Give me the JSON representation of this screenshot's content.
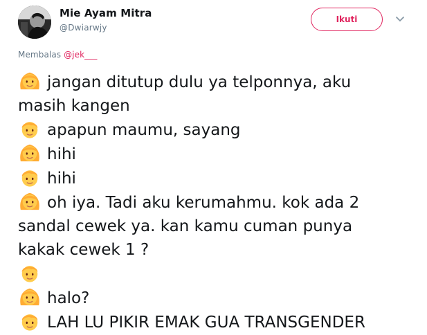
{
  "tweet": {
    "author": {
      "display_name": "Mie Ayam Mitra",
      "handle": "@Dwiarwjy",
      "avatar_icon": "profile-photo-avatar"
    },
    "follow_button": {
      "label": "Ikuti"
    },
    "menu_icon": "chevron-down-icon",
    "reply": {
      "prefix": "Membalas",
      "mention": "@jek___"
    },
    "lines": [
      {
        "emoji": "girl-emoji",
        "text": "jangan ditutup dulu ya telponnya, aku"
      },
      {
        "emoji": "",
        "text": "masih kangen"
      },
      {
        "emoji": "boy-emoji",
        "text": "apapun maumu, sayang"
      },
      {
        "emoji": "girl-emoji",
        "text": "hihi"
      },
      {
        "emoji": "boy-emoji",
        "text": "hihi"
      },
      {
        "emoji": "girl-emoji",
        "text": "oh iya. Tadi aku kerumahmu. kok ada 2"
      },
      {
        "emoji": "",
        "text": "sandal cewek ya. kan kamu cuman punya"
      },
      {
        "emoji": "",
        "text": "kakak cewek 1 ?"
      },
      {
        "emoji": "boy-emoji",
        "text": ""
      },
      {
        "emoji": "girl-emoji",
        "text": "halo?"
      },
      {
        "emoji": "boy-emoji",
        "text": "LAH LU PIKIR EMAK GUA TRANSGENDER"
      }
    ],
    "colors": {
      "accent": "#e0245e",
      "secondary_text": "#657786",
      "primary_text": "#14171a",
      "emoji_skin": "#ffcc4d",
      "emoji_hair": "#ffac33"
    }
  }
}
